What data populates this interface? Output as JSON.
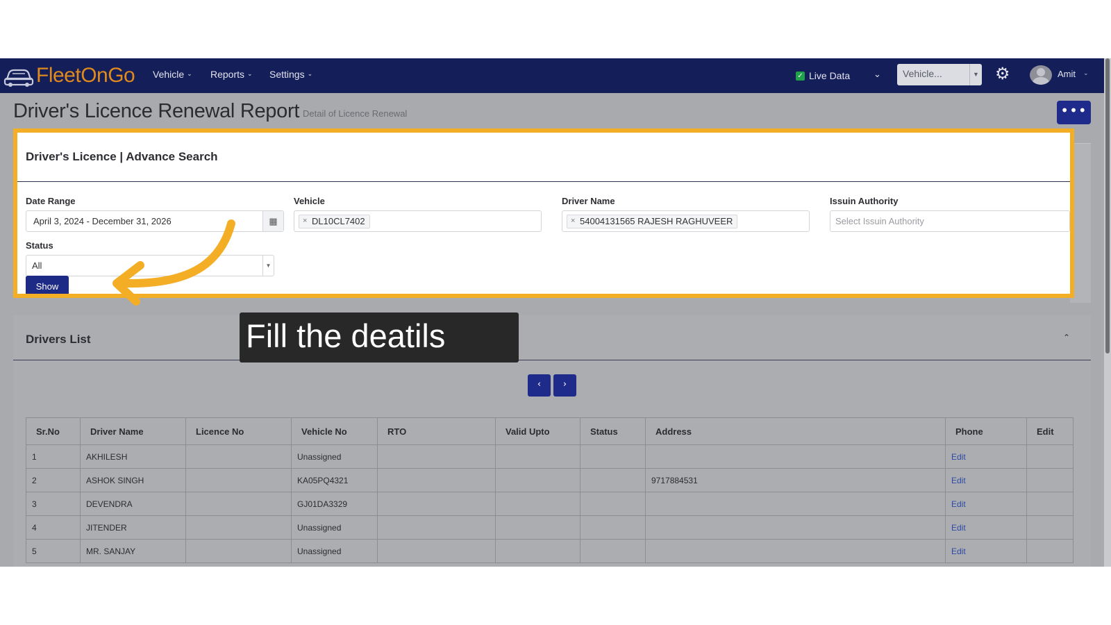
{
  "navbar": {
    "brand": "FleetOnGo",
    "menus": [
      "Vehicle",
      "Reports",
      "Settings"
    ],
    "live_data_label": "Live Data",
    "vehicle_select_value": "Vehicle...",
    "user_name": "Amit"
  },
  "page": {
    "title": "Driver's Licence Renewal Report",
    "subtitle": "Detail of Licence Renewal",
    "more_button": "•••"
  },
  "search": {
    "title": "Driver's Licence | Advance Search",
    "date_range": {
      "label": "Date Range",
      "value": "April 3, 2024 - December 31, 2026"
    },
    "vehicle": {
      "label": "Vehicle",
      "value": "DL10CL7402"
    },
    "driver_name": {
      "label": "Driver Name",
      "value": "54004131565 RAJESH RAGHUVEER"
    },
    "issuing_authority": {
      "label": "Issuin Authority",
      "placeholder": "Select Issuin Authority"
    },
    "status": {
      "label": "Status",
      "value": "All"
    },
    "show_button": "Show"
  },
  "tooltip": "Fill the deatils",
  "drivers": {
    "title": "Drivers List",
    "prev": "‹",
    "next": "›",
    "columns": [
      "Sr.No",
      "Driver Name",
      "Licence No",
      "Vehicle No",
      "RTO",
      "Valid Upto",
      "Status",
      "Address",
      "Phone",
      "Edit"
    ],
    "rows": [
      {
        "sr": "1",
        "name": "AKHILESH",
        "licence": "",
        "vehicle": "Unassigned",
        "rto": "",
        "valid": "",
        "status": "",
        "address": "",
        "phone": "Edit"
      },
      {
        "sr": "2",
        "name": "ASHOK SINGH",
        "licence": "",
        "vehicle": "KA05PQ4321",
        "rto": "",
        "valid": "",
        "status": "",
        "address": "9717884531",
        "phone": "Edit"
      },
      {
        "sr": "3",
        "name": "DEVENDRA",
        "licence": "",
        "vehicle": "GJ01DA3329",
        "rto": "",
        "valid": "",
        "status": "",
        "address": "",
        "phone": "Edit"
      },
      {
        "sr": "4",
        "name": "JITENDER",
        "licence": "",
        "vehicle": "Unassigned",
        "rto": "",
        "valid": "",
        "status": "",
        "address": "",
        "phone": "Edit"
      },
      {
        "sr": "5",
        "name": "MR. SANJAY",
        "licence": "",
        "vehicle": "Unassigned",
        "rto": "",
        "valid": "",
        "status": "",
        "address": "",
        "phone": "Edit"
      }
    ]
  }
}
